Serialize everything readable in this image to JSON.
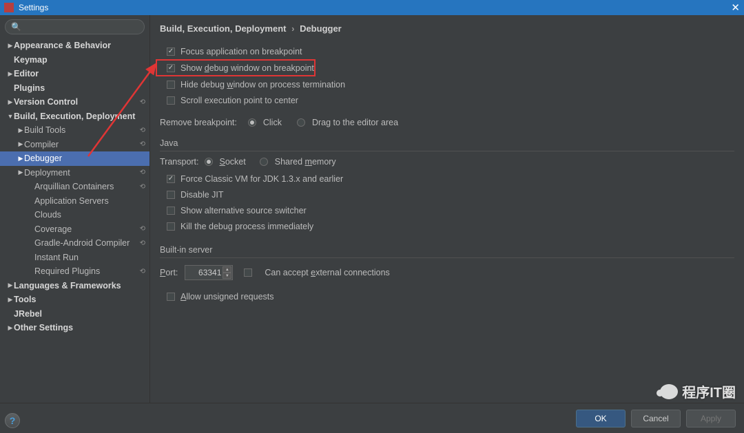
{
  "window": {
    "title": "Settings",
    "close": "✕"
  },
  "search": {
    "placeholder": ""
  },
  "tree": [
    {
      "label": "Appearance & Behavior",
      "depth": 0,
      "arrow": "▶",
      "bold": true
    },
    {
      "label": "Keymap",
      "depth": 0,
      "arrow": "",
      "bold": true
    },
    {
      "label": "Editor",
      "depth": 0,
      "arrow": "▶",
      "bold": true
    },
    {
      "label": "Plugins",
      "depth": 0,
      "arrow": "",
      "bold": true
    },
    {
      "label": "Version Control",
      "depth": 0,
      "arrow": "▶",
      "bold": true,
      "reset": true
    },
    {
      "label": "Build, Execution, Deployment",
      "depth": 0,
      "arrow": "▼",
      "bold": true
    },
    {
      "label": "Build Tools",
      "depth": 1,
      "arrow": "▶",
      "reset": true
    },
    {
      "label": "Compiler",
      "depth": 1,
      "arrow": "▶",
      "reset": true
    },
    {
      "label": "Debugger",
      "depth": 1,
      "arrow": "▶",
      "selected": true
    },
    {
      "label": "Deployment",
      "depth": 1,
      "arrow": "▶",
      "reset": true
    },
    {
      "label": "Arquillian Containers",
      "depth": 2,
      "arrow": "",
      "reset": true
    },
    {
      "label": "Application Servers",
      "depth": 2,
      "arrow": ""
    },
    {
      "label": "Clouds",
      "depth": 2,
      "arrow": ""
    },
    {
      "label": "Coverage",
      "depth": 2,
      "arrow": "",
      "reset": true
    },
    {
      "label": "Gradle-Android Compiler",
      "depth": 2,
      "arrow": "",
      "reset": true
    },
    {
      "label": "Instant Run",
      "depth": 2,
      "arrow": ""
    },
    {
      "label": "Required Plugins",
      "depth": 2,
      "arrow": "",
      "reset": true
    },
    {
      "label": "Languages & Frameworks",
      "depth": 0,
      "arrow": "▶",
      "bold": true
    },
    {
      "label": "Tools",
      "depth": 0,
      "arrow": "▶",
      "bold": true
    },
    {
      "label": "JRebel",
      "depth": 0,
      "arrow": "",
      "bold": true
    },
    {
      "label": "Other Settings",
      "depth": 0,
      "arrow": "▶",
      "bold": true
    }
  ],
  "breadcrumb": {
    "a": "Build, Execution, Deployment",
    "sep": "›",
    "b": "Debugger"
  },
  "opts": {
    "focus": "Focus application on breakpoint",
    "showdbg_pre": "Show ",
    "showdbg_u": "d",
    "showdbg_post": "ebug window on breakpoint",
    "hide_pre": "Hide debug ",
    "hide_u": "w",
    "hide_post": "indow on process termination",
    "scroll": "Scroll execution point to center",
    "remove_label": "Remove breakpoint:",
    "remove_click": "Click",
    "remove_drag": "Drag to the editor area"
  },
  "java": {
    "head": "Java",
    "transport": "Transport:",
    "socket_u": "S",
    "socket_post": "ocket",
    "shared_pre": "Shared ",
    "shared_u": "m",
    "shared_post": "emory",
    "force": "Force Classic VM for JDK 1.3.x and earlier",
    "disable": "Disable JIT",
    "alt": "Show alternative source switcher",
    "kill": "Kill the debug process immediately"
  },
  "server": {
    "head": "Built-in server",
    "port_u": "P",
    "port_post": "ort:",
    "port_value": "63341",
    "accept_pre": "Can accept ",
    "accept_u": "e",
    "accept_post": "xternal connections",
    "allow_u": "A",
    "allow_post": "llow unsigned requests"
  },
  "buttons": {
    "ok": "OK",
    "cancel": "Cancel",
    "apply": "Apply"
  },
  "help": "?",
  "watermark": "程序IT圈"
}
